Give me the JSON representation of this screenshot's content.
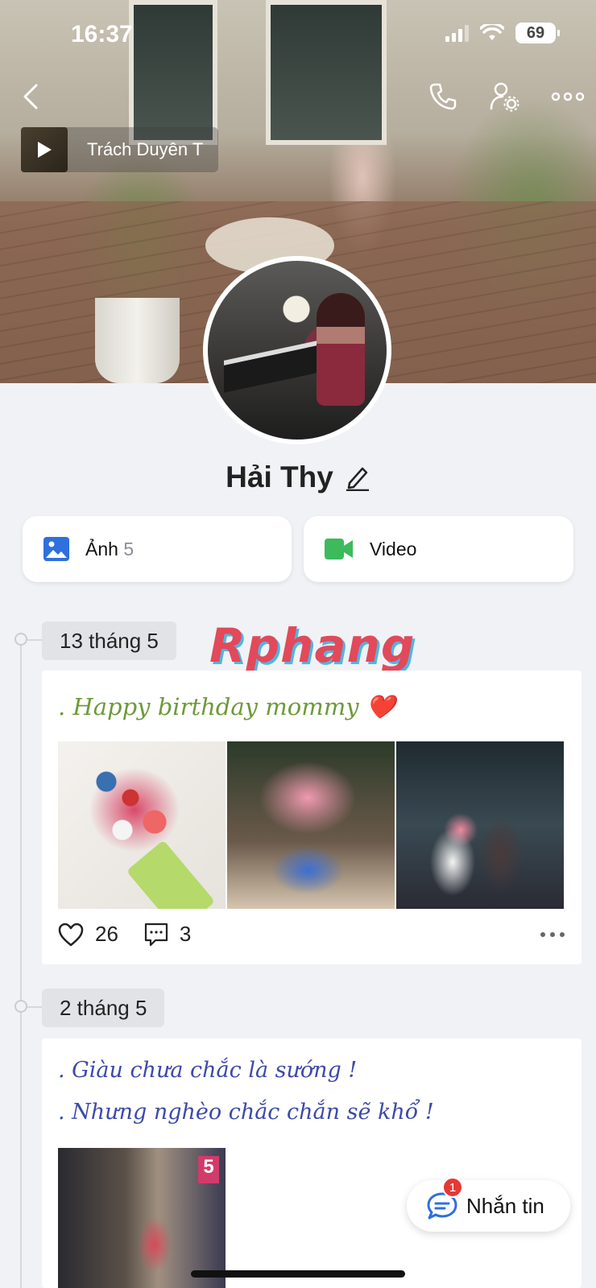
{
  "status_bar": {
    "time": "16:37",
    "battery": "69"
  },
  "header": {
    "back_icon": "chevron-left-icon",
    "call_icon": "phone-icon",
    "profile_settings_icon": "user-gear-icon",
    "more_icon": "more-horizontal-icon"
  },
  "music": {
    "title": "Trách Duyên T"
  },
  "profile": {
    "name": "Hải Thy"
  },
  "media": {
    "photos_label": "Ảnh",
    "photos_count": "5",
    "video_label": "Video"
  },
  "watermark": "Rphang",
  "posts": [
    {
      "date": "13 tháng 5",
      "text": ". Happy birthday mommy",
      "emoji": "❤️",
      "likes": "26",
      "comments": "3"
    },
    {
      "date": "2 tháng 5",
      "lines": [
        ". Giàu chưa chắc là sướng !",
        ". Nhưng nghèo chắc chắn sẽ khổ !"
      ]
    }
  ],
  "fab": {
    "label": "Nhắn tin",
    "badge": "1"
  },
  "colors": {
    "accent": "#2f6fde",
    "video_green": "#3dba5c",
    "badge_red": "#e53935"
  }
}
